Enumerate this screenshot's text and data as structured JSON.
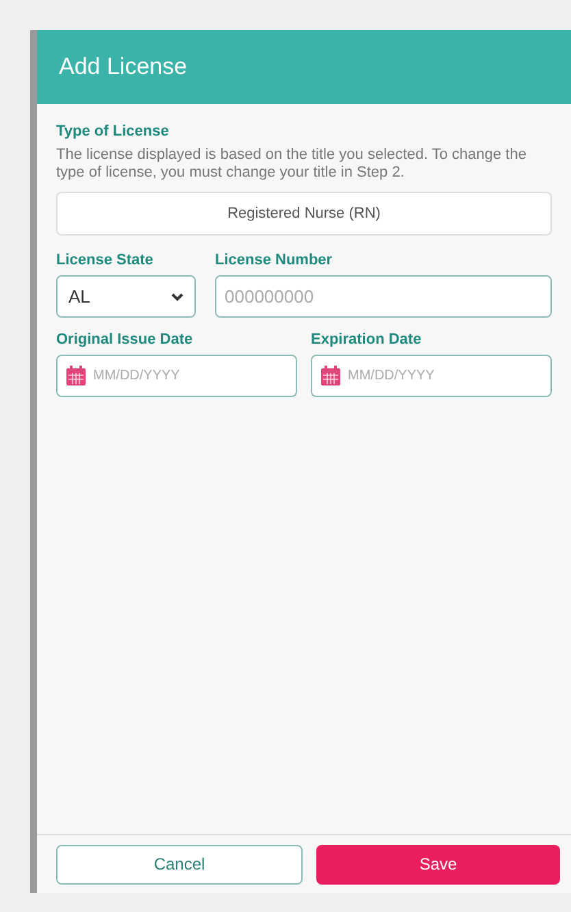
{
  "dialog": {
    "title": "Add License"
  },
  "type_of_license": {
    "label": "Type of License",
    "description": "The license displayed is based on the title you selected. To change the type of license, you must change your title in Step 2.",
    "value": "Registered Nurse (RN)"
  },
  "license_state": {
    "label": "License State",
    "value": "AL"
  },
  "license_number": {
    "label": "License Number",
    "placeholder": "000000000"
  },
  "original_issue_date": {
    "label": "Original Issue Date",
    "placeholder": "MM/DD/YYYY"
  },
  "expiration_date": {
    "label": "Expiration Date",
    "placeholder": "MM/DD/YYYY"
  },
  "buttons": [
    {
      "kind": "secondary",
      "label": "Cancel"
    },
    {
      "kind": "primary",
      "label": "Save"
    }
  ]
}
